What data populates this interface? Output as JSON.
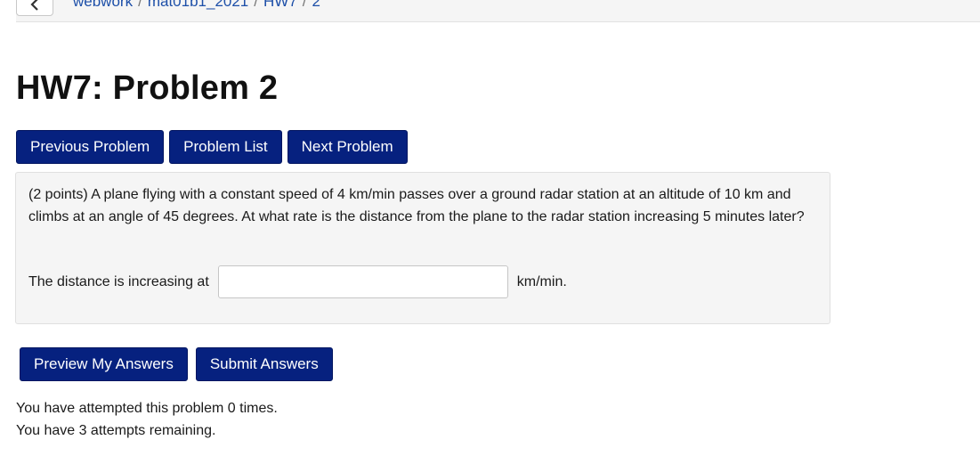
{
  "breadcrumb": {
    "items": [
      "webwork",
      "mat01b1_2021",
      "HW7",
      "2"
    ],
    "separator": "/"
  },
  "page": {
    "title": "HW7: Problem 2"
  },
  "nav": {
    "previous_label": "Previous Problem",
    "list_label": "Problem List",
    "next_label": "Next Problem"
  },
  "problem": {
    "text": "(2 points) A plane flying with a constant speed of 4 km/min passes over a ground radar station at an altitude of 10 km and climbs at an angle of 45 degrees. At what rate is the distance from the plane to the radar station increasing 5 minutes later?",
    "answer_prefix": "The distance is increasing at",
    "answer_value": "",
    "answer_unit": "km/min."
  },
  "actions": {
    "preview_label": "Preview My Answers",
    "submit_label": "Submit Answers"
  },
  "status": {
    "attempted": "You have attempted this problem 0 times.",
    "remaining": "You have 3 attempts remaining."
  },
  "colors": {
    "button_bg": "#06217f",
    "link": "#1d4fa8",
    "panel_bg": "#f5f5f5"
  }
}
